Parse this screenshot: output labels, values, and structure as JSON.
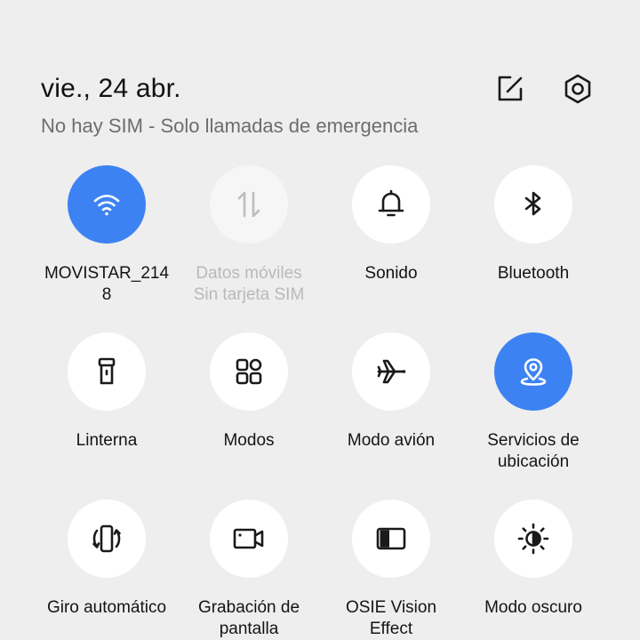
{
  "header": {
    "date": "vie., 24 abr.",
    "status": "No hay SIM - Solo llamadas de emergencia",
    "edit_icon": "edit-icon",
    "settings_icon": "settings-icon"
  },
  "colors": {
    "active": "#3d82f3",
    "tile_bg": "#ffffff",
    "disabled_bg": "#f6f6f6",
    "background": "#eeeeee"
  },
  "tiles": [
    {
      "label": "MOVISTAR_214\n8",
      "sub": "",
      "state": "active",
      "icon": "wifi-icon"
    },
    {
      "label": "Datos móviles",
      "sub": "Sin tarjeta SIM",
      "state": "disabled",
      "icon": "mobile-data-icon"
    },
    {
      "label": "Sonido",
      "sub": "",
      "state": "off",
      "icon": "bell-icon"
    },
    {
      "label": "Bluetooth",
      "sub": "",
      "state": "off",
      "icon": "bluetooth-icon"
    },
    {
      "label": "Linterna",
      "sub": "",
      "state": "off",
      "icon": "flashlight-icon"
    },
    {
      "label": "Modos",
      "sub": "",
      "state": "off",
      "icon": "modes-icon"
    },
    {
      "label": "Modo avión",
      "sub": "",
      "state": "off",
      "icon": "airplane-icon"
    },
    {
      "label": "Servicios de\nubicación",
      "sub": "",
      "state": "active",
      "icon": "location-icon"
    },
    {
      "label": "Giro automático",
      "sub": "",
      "state": "off",
      "icon": "auto-rotate-icon"
    },
    {
      "label": "Grabación de\npantalla",
      "sub": "",
      "state": "off",
      "icon": "screen-record-icon"
    },
    {
      "label": "OSIE Vision\nEffect",
      "sub": "",
      "state": "off",
      "icon": "vision-effect-icon"
    },
    {
      "label": "Modo oscuro",
      "sub": "",
      "state": "off",
      "icon": "dark-mode-icon"
    }
  ]
}
